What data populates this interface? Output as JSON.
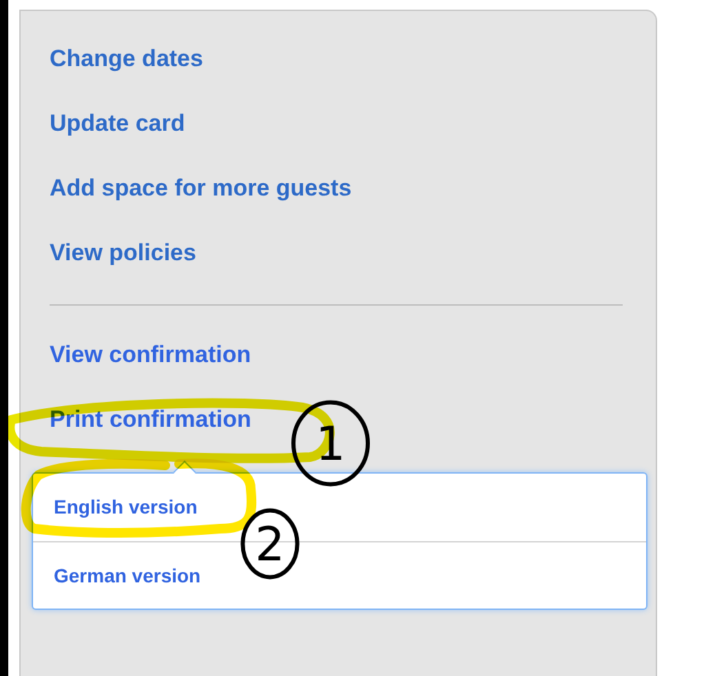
{
  "menu_links": [
    {
      "label": "Change dates"
    },
    {
      "label": "Update card"
    },
    {
      "label": "Add space for more guests"
    },
    {
      "label": "View policies"
    }
  ],
  "confirmation_links": [
    {
      "label": "View confirmation"
    },
    {
      "label": "Print confirmation"
    }
  ],
  "print_dropdown": {
    "options": [
      {
        "label": "English version"
      },
      {
        "label": "German version"
      }
    ]
  },
  "annotations": [
    {
      "label": "1"
    },
    {
      "label": "2"
    }
  ]
}
